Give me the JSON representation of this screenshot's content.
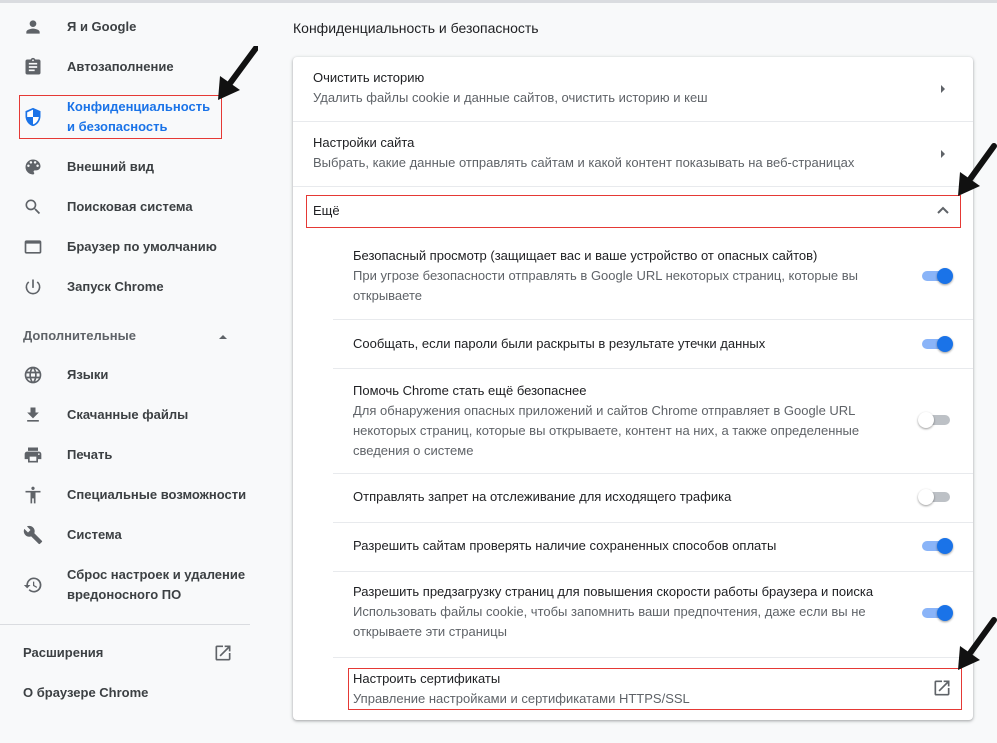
{
  "sidebar": {
    "items": [
      {
        "label": "Я и Google",
        "icon": "person-icon"
      },
      {
        "label": "Автозаполнение",
        "icon": "clipboard-icon"
      },
      {
        "label": "Конфиденциальность и безопасность",
        "icon": "shield-icon",
        "active": true
      },
      {
        "label": "Внешний вид",
        "icon": "palette-icon"
      },
      {
        "label": "Поисковая система",
        "icon": "search-icon"
      },
      {
        "label": "Браузер по умолчанию",
        "icon": "browser-window-icon"
      },
      {
        "label": "Запуск Chrome",
        "icon": "power-icon"
      }
    ],
    "advanced_label": "Дополнительные",
    "advanced_items": [
      {
        "label": "Языки",
        "icon": "globe-icon"
      },
      {
        "label": "Скачанные файлы",
        "icon": "download-icon"
      },
      {
        "label": "Печать",
        "icon": "printer-icon"
      },
      {
        "label": "Специальные возможности",
        "icon": "accessibility-icon"
      },
      {
        "label": "Система",
        "icon": "wrench-icon"
      },
      {
        "label": "Сброс настроек и удаление вредоносного ПО",
        "icon": "restore-icon"
      }
    ],
    "extensions_label": "Расширения",
    "about_label": "О браузере Chrome"
  },
  "main": {
    "section_title": "Конфиденциальность и безопасность",
    "clear_history": {
      "title": "Очистить историю",
      "subtitle": "Удалить файлы cookie и данные сайтов, очистить историю и кеш"
    },
    "site_settings": {
      "title": "Настройки сайта",
      "subtitle": "Выбрать, какие данные отправлять сайтам и какой контент показывать на веб-страницах"
    },
    "more_label": "Ещё",
    "settings": [
      {
        "title": "Безопасный просмотр (защищает вас и ваше устройство от опасных сайтов)",
        "subtitle_lines": [
          "При угрозе безопасности отправлять в Google URL некоторых страниц, которые вы",
          "открываете"
        ],
        "enabled": true
      },
      {
        "title": "Сообщать, если пароли были раскрыты в результате утечки данных",
        "subtitle_lines": [],
        "enabled": true
      },
      {
        "title": "Помочь Chrome стать ещё безопаснее",
        "subtitle_lines": [
          "Для обнаружения опасных приложений и сайтов Chrome отправляет в Google URL",
          "некоторых страниц, которые вы открываете, контент на них, а также определенные",
          "сведения о системе"
        ],
        "enabled": false
      },
      {
        "title": "Отправлять запрет на отслеживание для исходящего трафика",
        "subtitle_lines": [],
        "enabled": false
      },
      {
        "title": "Разрешить сайтам проверять наличие сохраненных способов оплаты",
        "subtitle_lines": [],
        "enabled": true
      },
      {
        "title": "Разрешить предзагрузку страниц для повышения скорости работы браузера и поиска",
        "subtitle_lines": [
          "Использовать файлы cookie, чтобы запомнить ваши предпочтения, даже если вы не",
          "открываете эти страницы"
        ],
        "enabled": true
      }
    ],
    "certificates": {
      "title": "Настроить сертификаты",
      "subtitle": "Управление настройками и сертификатами HTTPS/SSL"
    }
  },
  "colors": {
    "accent": "#1a73e8",
    "highlight_box": "#e53935"
  }
}
